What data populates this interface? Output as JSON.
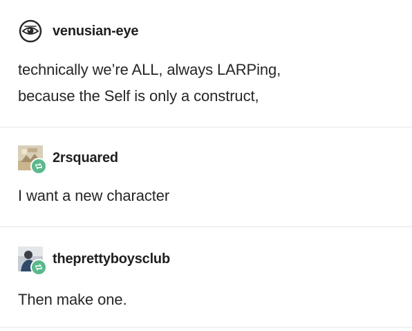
{
  "posts": [
    {
      "username": "venusian-eye",
      "text_lines": [
        "technically we’re ALL, always LARPing,",
        "because the Self is only a construct,"
      ],
      "avatar": "eye-avatar-icon",
      "reblog": false
    },
    {
      "username": "2rsquared",
      "text_lines": [
        "I want a new character"
      ],
      "avatar": "photo-avatar-icon",
      "reblog": true
    },
    {
      "username": "theprettyboysclub",
      "text_lines": [
        "Then make one."
      ],
      "avatar": "person-avatar-icon",
      "reblog": true
    }
  ],
  "colors": {
    "reblog_badge": "#5bb88c",
    "divider": "#e6e6e6",
    "text": "#262626"
  }
}
